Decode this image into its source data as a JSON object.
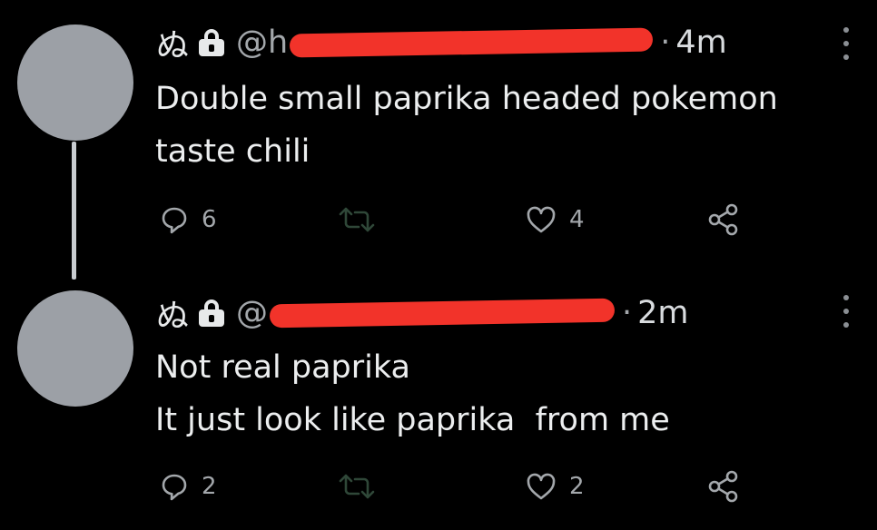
{
  "tweets": [
    {
      "name": "ぬ",
      "handle_visible": "@h",
      "separator": "·",
      "time": "4m",
      "lines": [
        "Double small paprika headed pokemon",
        "taste chili"
      ],
      "reply_count": "6",
      "retweet_count": "",
      "like_count": "4"
    },
    {
      "name": "ぬ",
      "handle_visible": "@",
      "separator": "·",
      "time": "2m",
      "lines": [
        "Not real paprika",
        "It just look like paprika  from me"
      ],
      "reply_count": "2",
      "retweet_count": "",
      "like_count": "2"
    }
  ],
  "icons": {
    "lock": "lock-icon",
    "more": "more-options-icon",
    "reply": "reply-icon",
    "retweet": "retweet-icon",
    "like": "heart-icon",
    "share": "share-icon"
  },
  "colors": {
    "background": "#000000",
    "text": "#e7e9ea",
    "muted": "#a3a7ab",
    "avatar": "#9ca0a6",
    "redaction": "#f2332a"
  }
}
